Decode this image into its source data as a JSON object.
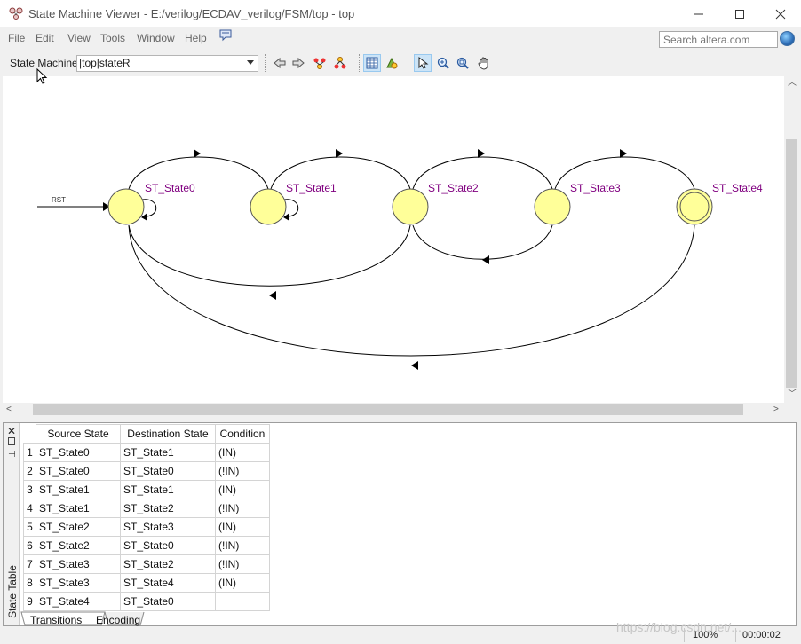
{
  "window": {
    "title": "State Machine Viewer - E:/verilog/ECDAV_verilog/FSM/top - top"
  },
  "menu": {
    "items": [
      "File",
      "Edit",
      "View",
      "Tools",
      "Window",
      "Help"
    ]
  },
  "search": {
    "placeholder": "Search altera.com"
  },
  "toolbar": {
    "state_machine_label": "State Machine:",
    "state_machine_value": "|top|stateR",
    "icons": [
      "back-icon",
      "forward-icon",
      "highlight-fanin-icon",
      "highlight-fanout-icon",
      "table-icon",
      "legend-icon",
      "select-icon",
      "zoom-icon",
      "zoom-fit-icon",
      "pan-icon"
    ]
  },
  "diagram": {
    "reset_label": "RST",
    "states": [
      "ST_State0",
      "ST_State1",
      "ST_State2",
      "ST_State3",
      "ST_State4"
    ],
    "state_fill": "#ffff99",
    "label_color": "#800080"
  },
  "state_table": {
    "panel_title": "State Table",
    "headers": [
      "Source State",
      "Destination State",
      "Condition"
    ],
    "rows": [
      {
        "num": "1",
        "source": "ST_State0",
        "dest": "ST_State1",
        "cond": "(IN)"
      },
      {
        "num": "2",
        "source": "ST_State0",
        "dest": "ST_State0",
        "cond": "(!IN)"
      },
      {
        "num": "3",
        "source": "ST_State1",
        "dest": "ST_State1",
        "cond": "(IN)"
      },
      {
        "num": "4",
        "source": "ST_State1",
        "dest": "ST_State2",
        "cond": "(!IN)"
      },
      {
        "num": "5",
        "source": "ST_State2",
        "dest": "ST_State3",
        "cond": "(IN)"
      },
      {
        "num": "6",
        "source": "ST_State2",
        "dest": "ST_State0",
        "cond": "(!IN)"
      },
      {
        "num": "7",
        "source": "ST_State3",
        "dest": "ST_State2",
        "cond": "(!IN)"
      },
      {
        "num": "8",
        "source": "ST_State3",
        "dest": "ST_State4",
        "cond": "(IN)"
      },
      {
        "num": "9",
        "source": "ST_State4",
        "dest": "ST_State0",
        "cond": ""
      }
    ],
    "tabs": [
      "Transitions",
      "Encoding"
    ]
  },
  "status": {
    "zoom": "100%",
    "elapsed": "00:00:02"
  },
  "watermark": "https://blog.csdn.net/..."
}
